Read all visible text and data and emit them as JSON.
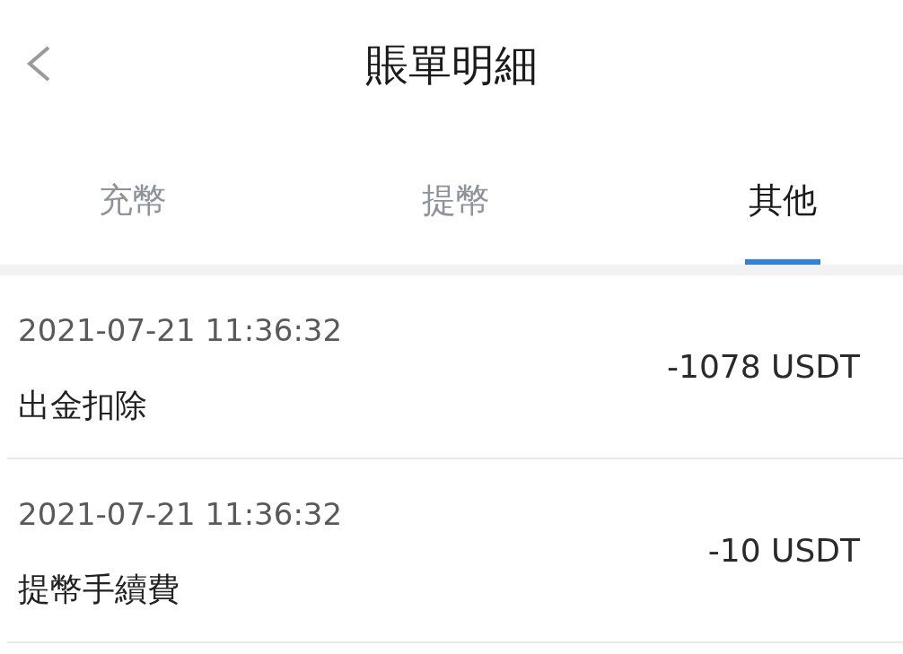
{
  "header": {
    "title": "賬單明細"
  },
  "tabs": [
    {
      "label": "充幣",
      "selected": false
    },
    {
      "label": "提幣",
      "selected": false
    },
    {
      "label": "其他",
      "selected": true
    }
  ],
  "records": [
    {
      "time": "2021-07-21 11:36:32",
      "description": "出金扣除",
      "amount": "-1078 USDT"
    },
    {
      "time": "2021-07-21 11:36:32",
      "description": "提幣手續費",
      "amount": "-10 USDT"
    }
  ]
}
